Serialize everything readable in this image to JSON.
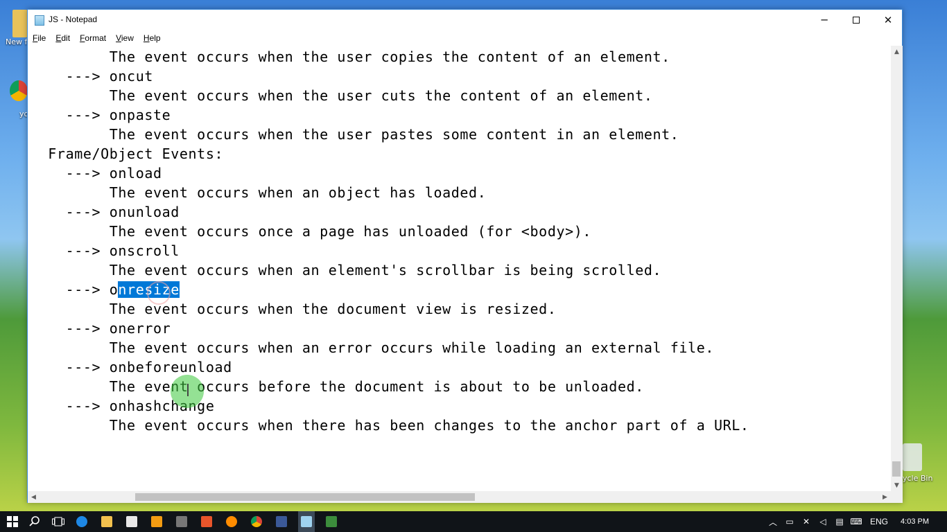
{
  "desktop": {
    "newfolder_label": "New f",
    "chrome_label": "yo",
    "bin_label": "ycle Bin"
  },
  "window": {
    "title": "JS - Notepad",
    "minimize_glyph": "─",
    "close_glyph": "✕"
  },
  "menu": [
    {
      "u": "F",
      "rest": "ile"
    },
    {
      "u": "E",
      "rest": "dit"
    },
    {
      "u": "F",
      "rest": "ormat",
      "prefix": ""
    },
    {
      "u": "V",
      "rest": "iew"
    },
    {
      "u": "H",
      "rest": "elp"
    }
  ],
  "editor": {
    "lines": [
      "         The event occurs when the user copies the content of an element.",
      "    ---> oncut",
      "         The event occurs when the user cuts the content of an element.",
      "    ---> onpaste",
      "         The event occurs when the user pastes some content in an element.",
      "  Frame/Object Events:",
      "    ---> onload",
      "         The event occurs when an object has loaded.",
      "    ---> onunload",
      "         The event occurs once a page has unloaded (for <body>).",
      "    ---> onscroll",
      "         The event occurs when an element's scrollbar is being scrolled.",
      "    ---> o",
      "         The event occurs when the document view is resized.",
      "    ---> onerror",
      "         The event occurs when an error occurs while loading an external file.",
      "    ---> onbeforeunload",
      "         The event occurs before the document is about to be unloaded.",
      "    ---> onhashchange",
      "         The event occurs when there has been changes to the anchor part of a URL."
    ],
    "selected_text": "nresize"
  },
  "scroll": {
    "up": "▲",
    "down": "▼",
    "left": "◀",
    "right": "▶"
  },
  "taskbar": {
    "start_icon": "windows-logo-icon",
    "language": "ENG",
    "time": "4:03 PM",
    "accent": "#0078d7"
  }
}
